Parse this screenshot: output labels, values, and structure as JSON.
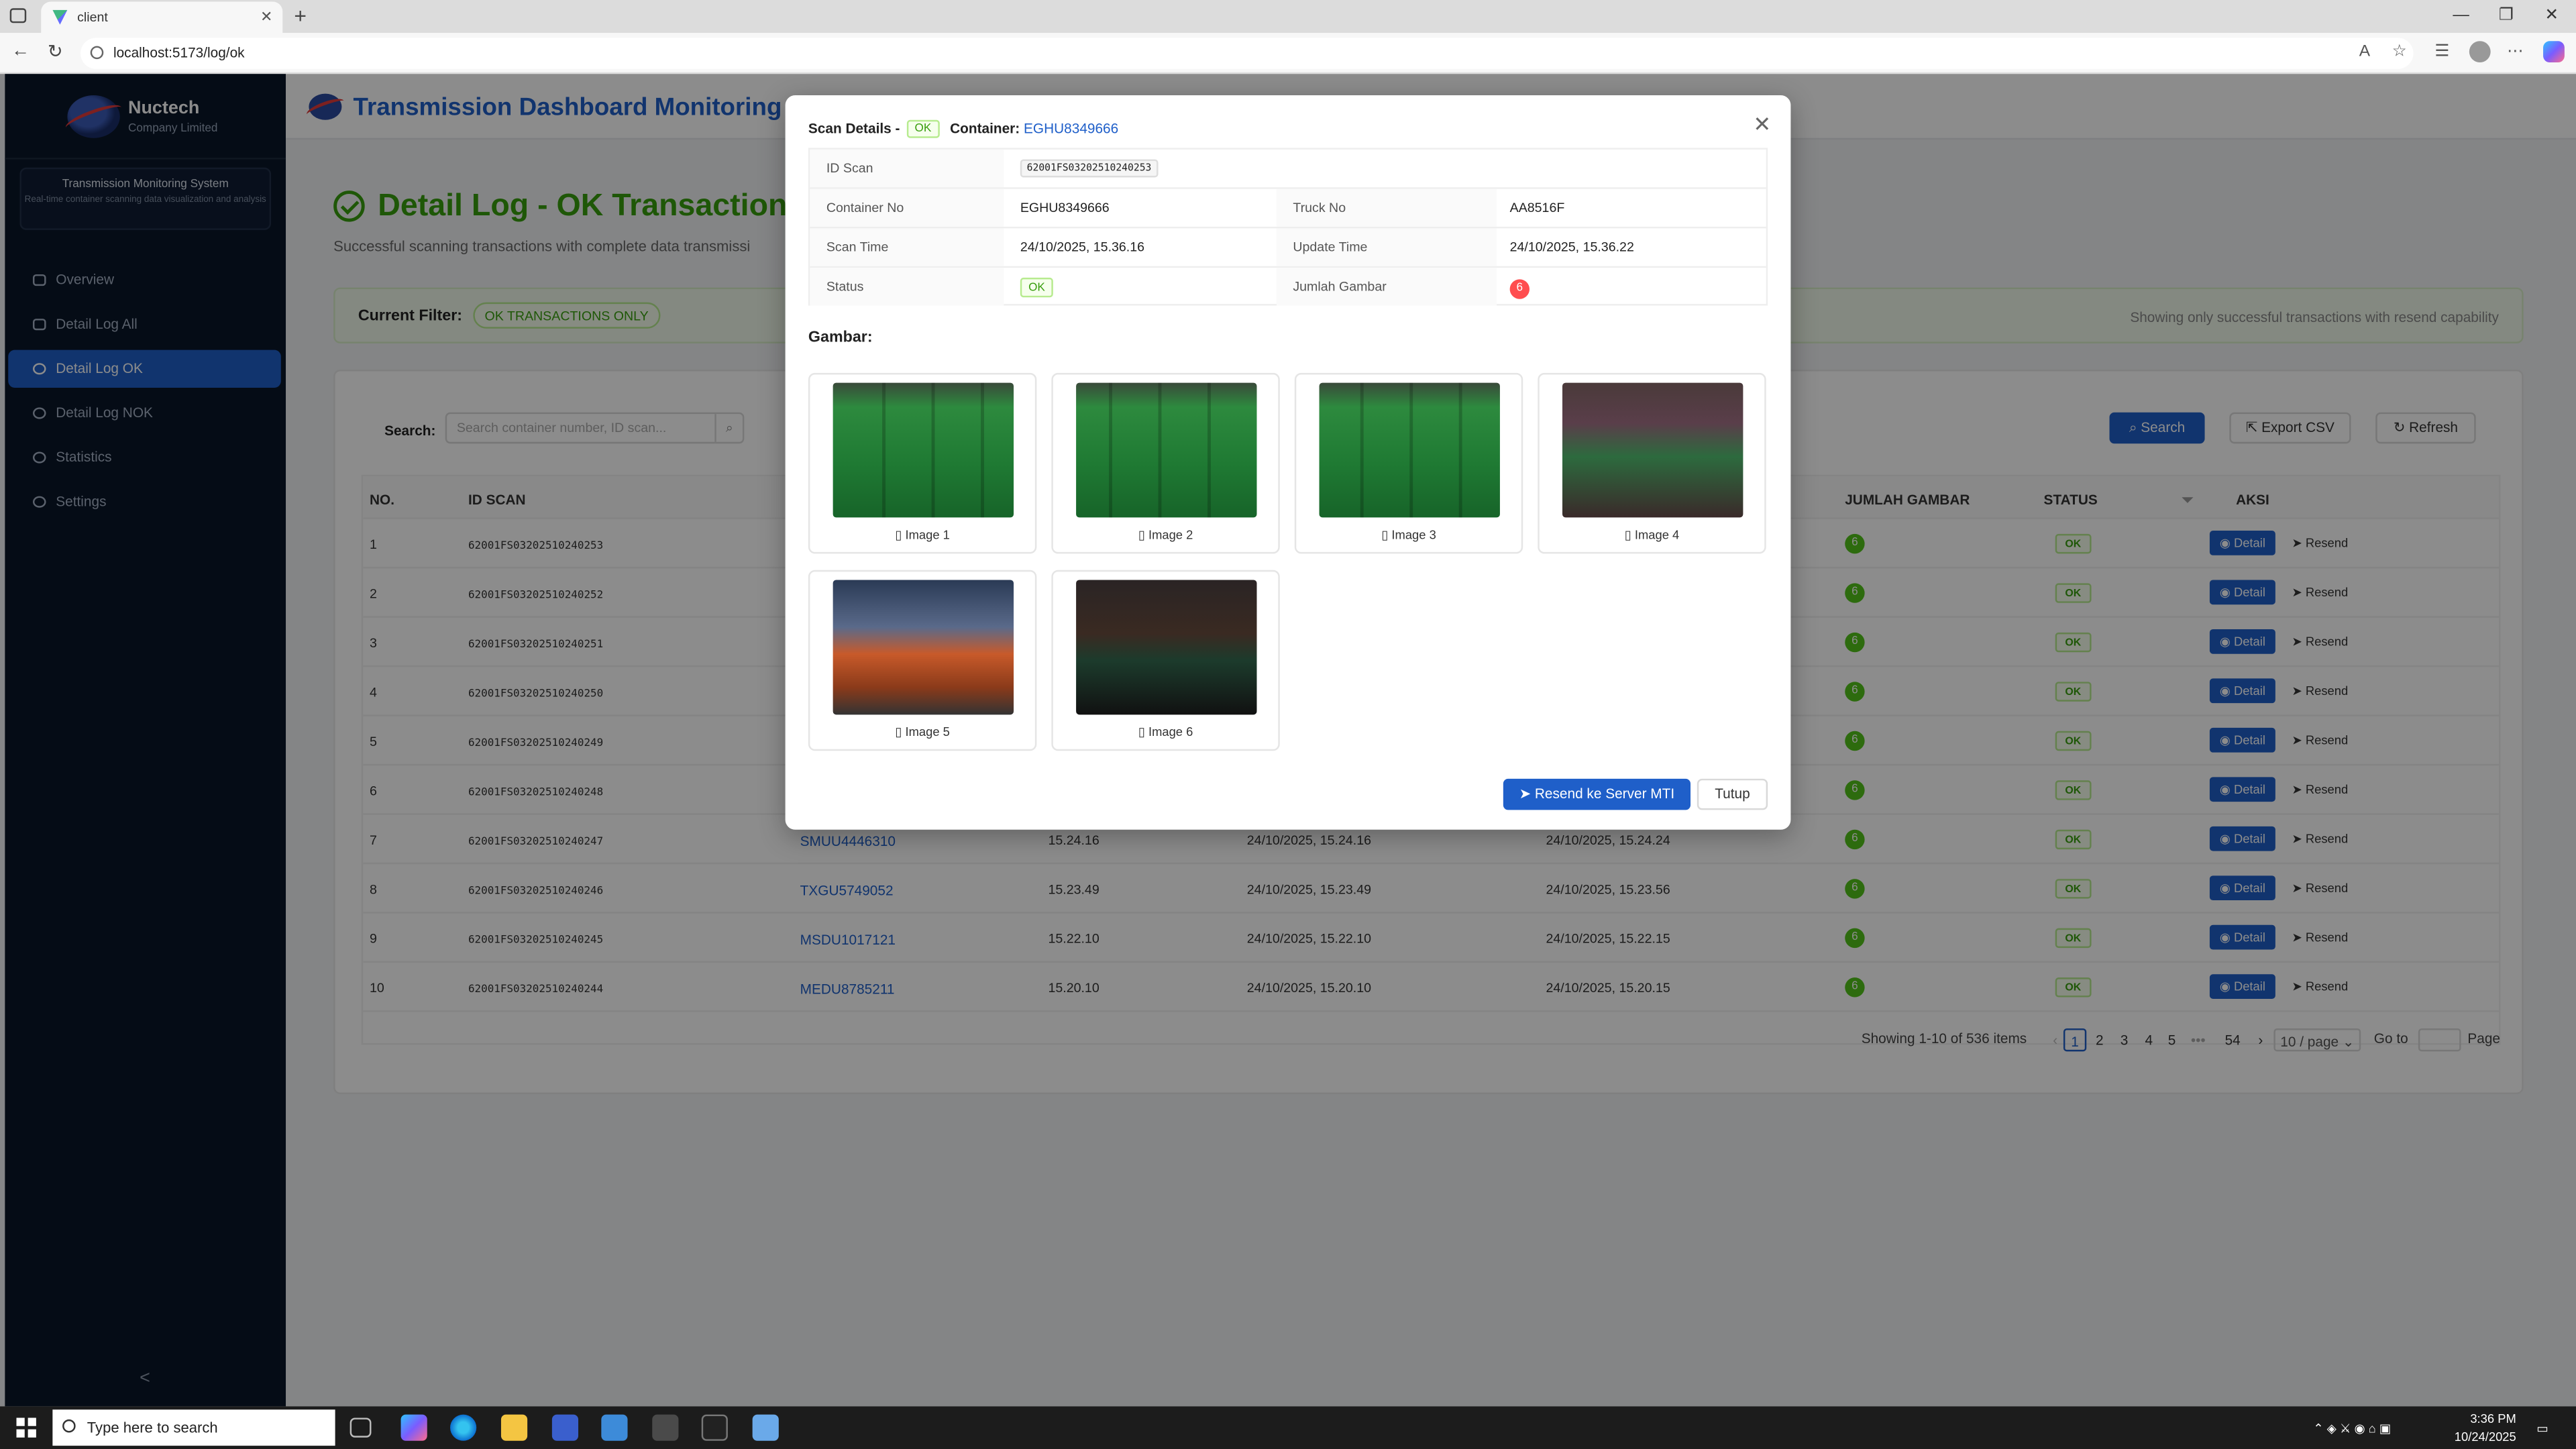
{
  "browser": {
    "tab_title": "client",
    "url": "localhost:5173/log/ok"
  },
  "sidebar": {
    "brand": "Nuctech",
    "brand_sub": "Company Limited",
    "system_title": "Transmission Monitoring System",
    "system_desc": "Real-time container scanning data visualization and analysis",
    "items": [
      {
        "label": "Overview"
      },
      {
        "label": "Detail Log All"
      },
      {
        "label": "Detail Log OK"
      },
      {
        "label": "Detail Log NOK"
      },
      {
        "label": "Statistics"
      },
      {
        "label": "Settings"
      }
    ],
    "collapse_glyph": "<"
  },
  "header": {
    "title": "Transmission Dashboard Monitoring"
  },
  "page": {
    "title": "Detail Log - OK Transactions",
    "subtitle": "Successful scanning transactions with complete data transmissi",
    "filter_label": "Current Filter:",
    "filter_tag": "OK TRANSACTIONS ONLY",
    "filter_note": "Showing only successful transactions with resend capability"
  },
  "toolbar": {
    "search_label": "Search:",
    "search_placeholder": "Search container number, ID scan...",
    "search_button": "Search",
    "export_button": "Export CSV",
    "refresh_button": "Refresh"
  },
  "table": {
    "headers": {
      "no": "NO.",
      "id": "ID SCAN",
      "jumlah": "JUMLAH GAMBAR",
      "status": "STATUS",
      "aksi": "AKSI"
    },
    "detail_label": "Detail",
    "resend_label": "Resend",
    "rows": [
      {
        "no": "1",
        "id": "62001FS03202510240253",
        "container": "",
        "t1": "",
        "t2": "",
        "t3": "",
        "count": "6",
        "status": "OK"
      },
      {
        "no": "2",
        "id": "62001FS03202510240252",
        "container": "",
        "t1": "",
        "t2": "",
        "t3": "",
        "count": "6",
        "status": "OK"
      },
      {
        "no": "3",
        "id": "62001FS03202510240251",
        "container": "",
        "t1": "",
        "t2": "",
        "t3": "",
        "count": "6",
        "status": "OK"
      },
      {
        "no": "4",
        "id": "62001FS03202510240250",
        "container": "",
        "t1": "",
        "t2": "",
        "t3": "",
        "count": "6",
        "status": "OK"
      },
      {
        "no": "5",
        "id": "62001FS03202510240249",
        "container": "",
        "t1": "",
        "t2": "",
        "t3": "",
        "count": "6",
        "status": "OK"
      },
      {
        "no": "6",
        "id": "62001FS03202510240248",
        "container": "",
        "t1": "",
        "t2": "",
        "t3": "",
        "count": "6",
        "status": "OK"
      },
      {
        "no": "7",
        "id": "62001FS03202510240247",
        "container": "SMUU4446310",
        "t1": "15.24.16",
        "t2": "24/10/2025, 15.24.16",
        "t3": "24/10/2025, 15.24.24",
        "count": "6",
        "status": "OK"
      },
      {
        "no": "8",
        "id": "62001FS03202510240246",
        "container": "TXGU5749052",
        "t1": "15.23.49",
        "t2": "24/10/2025, 15.23.49",
        "t3": "24/10/2025, 15.23.56",
        "count": "6",
        "status": "OK"
      },
      {
        "no": "9",
        "id": "62001FS03202510240245",
        "container": "MSDU1017121",
        "t1": "15.22.10",
        "t2": "24/10/2025, 15.22.10",
        "t3": "24/10/2025, 15.22.15",
        "count": "6",
        "status": "OK"
      },
      {
        "no": "10",
        "id": "62001FS03202510240244",
        "container": "MEDU8785211",
        "t1": "15.20.10",
        "t2": "24/10/2025, 15.20.10",
        "t3": "24/10/2025, 15.20.15",
        "count": "6",
        "status": "OK"
      }
    ]
  },
  "pagination": {
    "summary": "Showing 1-10 of 536 items",
    "pages": [
      "1",
      "2",
      "3",
      "4",
      "5",
      "•••",
      "54"
    ],
    "page_size": "10 / page",
    "goto_label": "Go to",
    "page_label": "Page"
  },
  "modal": {
    "title": "Scan Details -",
    "status_tag": "OK",
    "container_label": "Container:",
    "container_value": "EGHU8349666",
    "fields": {
      "id_scan_label": "ID Scan",
      "id_scan_value": "62001FS03202510240253",
      "container_label": "Container No",
      "container_value": "EGHU8349666",
      "truck_label": "Truck No",
      "truck_value": "AA8516F",
      "scan_time_label": "Scan Time",
      "scan_time_value": "24/10/2025, 15.36.16",
      "update_time_label": "Update Time",
      "update_time_value": "24/10/2025, 15.36.22",
      "status_label": "Status",
      "status_value": "OK",
      "jumlah_label": "Jumlah Gambar",
      "jumlah_value": "6"
    },
    "gallery_title": "Gambar:",
    "images": [
      {
        "caption": "Image 1"
      },
      {
        "caption": "Image 2"
      },
      {
        "caption": "Image 3"
      },
      {
        "caption": "Image 4"
      },
      {
        "caption": "Image 5"
      },
      {
        "caption": "Image 6"
      }
    ],
    "resend_button": "Resend ke Server MTI",
    "close_button": "Tutup"
  },
  "taskbar": {
    "search_placeholder": "Type here to search",
    "time": "3:36 PM",
    "date": "10/24/2025"
  },
  "colors": {
    "accent": "#1f5fc9",
    "success": "#389e0d",
    "sidebar": "#0a1628"
  }
}
